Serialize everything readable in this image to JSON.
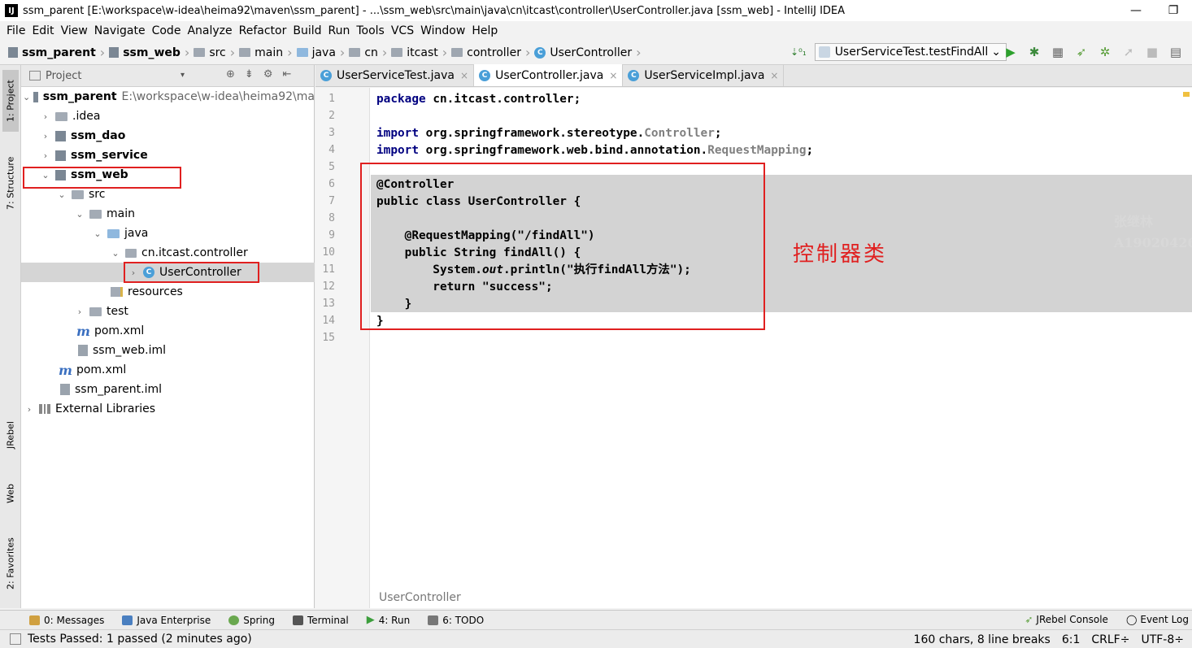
{
  "window": {
    "title": "ssm_parent [E:\\workspace\\w-idea\\heima92\\maven\\ssm_parent] - ...\\ssm_web\\src\\main\\java\\cn\\itcast\\controller\\UserController.java [ssm_web] - IntelliJ IDEA",
    "app_icon": "IJ",
    "minimize": "—",
    "restore": "❐"
  },
  "menu": [
    "File",
    "Edit",
    "View",
    "Navigate",
    "Code",
    "Analyze",
    "Refactor",
    "Build",
    "Run",
    "Tools",
    "VCS",
    "Window",
    "Help"
  ],
  "breadcrumbs": [
    "ssm_parent",
    "ssm_web",
    "src",
    "main",
    "java",
    "cn",
    "itcast",
    "controller",
    "UserController"
  ],
  "run_config": {
    "label": "UserServiceTest.testFindAll",
    "dropdown": "⌄"
  },
  "toolbar_icons": [
    "run-icon",
    "debug-icon",
    "coverage-icon",
    "jrebel-run-icon",
    "jrebel-debug-icon",
    "build-icon",
    "stop-icon",
    "project-structure-icon"
  ],
  "left_strip": {
    "project": "1: Project",
    "structure": "7: Structure",
    "jrebel": "JRebel",
    "web": "Web",
    "favorites": "2: Favorites"
  },
  "project_panel": {
    "header": "Project",
    "tree": [
      {
        "label": "ssm_parent",
        "path": "E:\\workspace\\w-idea\\heima92\\ma",
        "bold": true,
        "arrow": "⌄"
      },
      {
        "label": ".idea",
        "arrow": "›"
      },
      {
        "label": "ssm_dao",
        "bold": true,
        "arrow": "›"
      },
      {
        "label": "ssm_service",
        "bold": true,
        "arrow": "›"
      },
      {
        "label": "ssm_web",
        "bold": true,
        "arrow": "⌄"
      },
      {
        "label": "src",
        "arrow": "⌄"
      },
      {
        "label": "main",
        "arrow": "⌄"
      },
      {
        "label": "java",
        "arrow": "⌄"
      },
      {
        "label": "cn.itcast.controller",
        "arrow": "⌄"
      },
      {
        "label": "UserController",
        "arrow": "›"
      },
      {
        "label": "resources"
      },
      {
        "label": "test",
        "arrow": "›"
      },
      {
        "label": "pom.xml"
      },
      {
        "label": "ssm_web.iml"
      },
      {
        "label": "pom.xml"
      },
      {
        "label": "ssm_parent.iml"
      },
      {
        "label": "External Libraries",
        "arrow": "›"
      }
    ]
  },
  "tabs": [
    {
      "label": "UserServiceTest.java",
      "close": "×"
    },
    {
      "label": "UserController.java",
      "close": "×"
    },
    {
      "label": "UserServiceImpl.java",
      "close": "×"
    }
  ],
  "editor": {
    "line_numbers": [
      "1",
      "2",
      "3",
      "4",
      "5",
      "6",
      "7",
      "8",
      "9",
      "10",
      "11",
      "12",
      "13",
      "14",
      "15"
    ],
    "code": {
      "l1_kw": "package",
      "l1_rest": " cn.itcast.controller;",
      "l3_kw": "import",
      "l3_pkg": " org.springframework.stereotype.",
      "l3_cls": "Controller",
      "l3_end": ";",
      "l4_kw": "import",
      "l4_pkg": " org.springframework.web.bind.annotation.",
      "l4_cls": "RequestMapping",
      "l4_end": ";",
      "l6": "@Controller",
      "l7_kw": "public class",
      "l7_rest": " UserController {",
      "l9": "    @RequestMapping(\"/findAll\")",
      "l10_kw": "    public",
      "l10_rest": " String findAll() {",
      "l11_a": "        System.",
      "l11_b": "out",
      "l11_c": ".println(\"执行findAll方法\");",
      "l12_kw": "        return",
      "l12_str": " \"success\"",
      "l12_end": ";",
      "l13": "    }",
      "l14": "}"
    },
    "annotation": "控制器类",
    "watermark": [
      "张继林",
      "A190204262"
    ],
    "bottom_breadcrumb": "UserController"
  },
  "tool_windows": [
    {
      "label": "0: Messages",
      "color": "#d0a040"
    },
    {
      "label": "Java Enterprise",
      "color": "#4a7fc0"
    },
    {
      "label": "Spring",
      "color": "#6aa84f"
    },
    {
      "label": "Terminal",
      "color": "#555555"
    },
    {
      "label": "4: Run",
      "color": "#3c9e3c"
    },
    {
      "label": "6: TODO",
      "color": "#777777"
    }
  ],
  "tool_windows_right": [
    "JRebel Console",
    "Event Log"
  ],
  "status": {
    "message": "Tests Passed: 1 passed (2 minutes ago)",
    "chars": "160 chars, 8 line breaks",
    "position": "6:1",
    "line_sep": "CRLF÷",
    "encoding": "UTF-8÷"
  },
  "colors": {
    "keyword": "#000080",
    "string": "#008000",
    "highlight_red": "#e02020",
    "selection": "#d3d3d3"
  }
}
